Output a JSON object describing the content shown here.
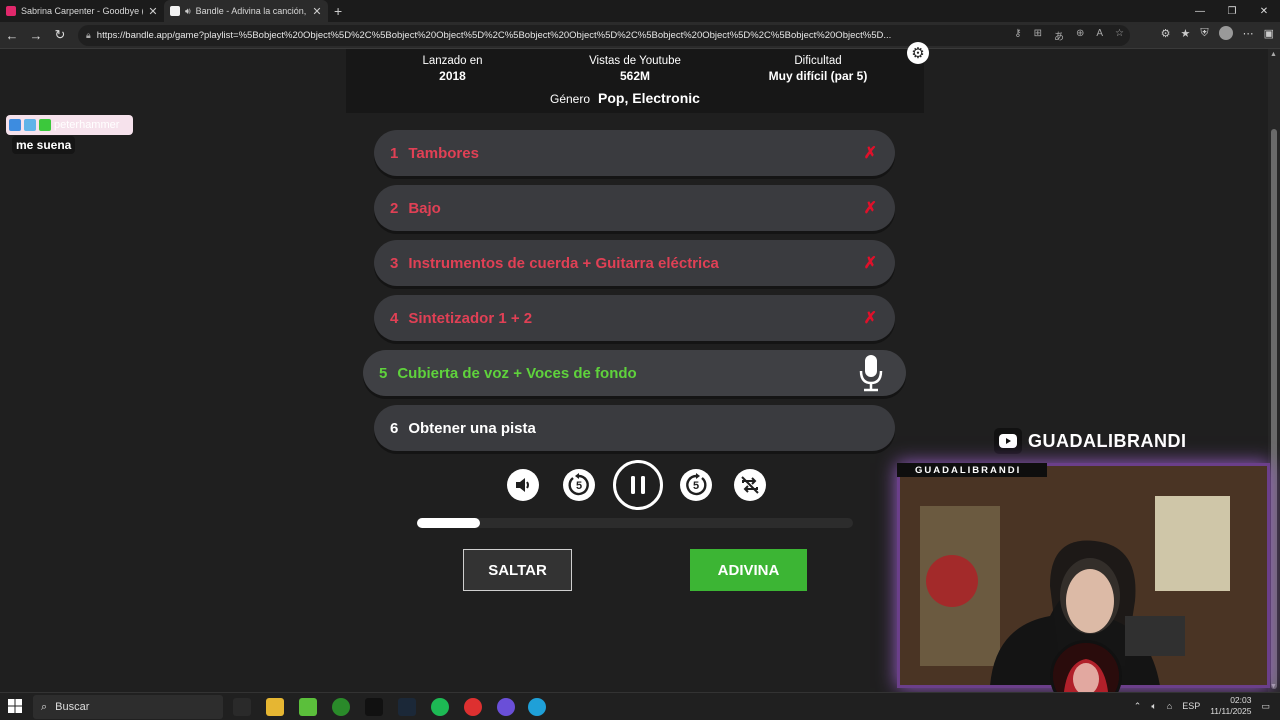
{
  "browser": {
    "tabs": [
      {
        "title": "Sabrina Carpenter - Goodbye (Of",
        "fav_color": "#e0286b",
        "active": false
      },
      {
        "title": "Bandle - Adivina la canción,",
        "fav_color": "#f2f2f2",
        "active": true
      }
    ],
    "url": "https://bandle.app/game?playlist=%5Bobject%20Object%5D%2C%5Bobject%20Object%5D%2C%5Bobject%20Object%5D%2C%5Bobject%20Object%5D%2C%5Bobject%20Object%5D..."
  },
  "song_info": {
    "released_label": "Lanzado en",
    "released_value": "2018",
    "views_label": "Vistas de Youtube",
    "views_value": "562M",
    "difficulty_label": "Dificultad",
    "difficulty_value": "Muy difícil (par 5)",
    "genre_label": "Género",
    "genre_value": "Pop, Electronic"
  },
  "tracks": [
    {
      "num": "1",
      "label": "Tambores",
      "state": "fail",
      "mark": "✗"
    },
    {
      "num": "2",
      "label": "Bajo",
      "state": "fail",
      "mark": "✗"
    },
    {
      "num": "3",
      "label": "Instrumentos de cuerda + Guitarra eléctrica",
      "state": "fail",
      "mark": "✗"
    },
    {
      "num": "4",
      "label": "Sintetizador 1 + 2",
      "state": "fail",
      "mark": "✗"
    },
    {
      "num": "5",
      "label": "Cubierta de voz + Voces de fondo",
      "state": "current",
      "mark": ""
    },
    {
      "num": "6",
      "label": "Obtener una pista",
      "state": "hint",
      "mark": ""
    }
  ],
  "controls": {
    "rewind_seconds": "5",
    "forward_seconds": "5",
    "progress_fraction": 0.145
  },
  "actions": {
    "skip_label": "SALTAR",
    "guess_label": "ADIVINA"
  },
  "chat": {
    "username": "peterhammer",
    "message": "me suena"
  },
  "stream": {
    "channel": "GUADALIBRANDI",
    "cam_label": "GUADALIBRANDI"
  },
  "taskbar": {
    "search_placeholder": "Buscar",
    "lang": "ESP",
    "time": "02:03",
    "date": "11/11/2025"
  }
}
